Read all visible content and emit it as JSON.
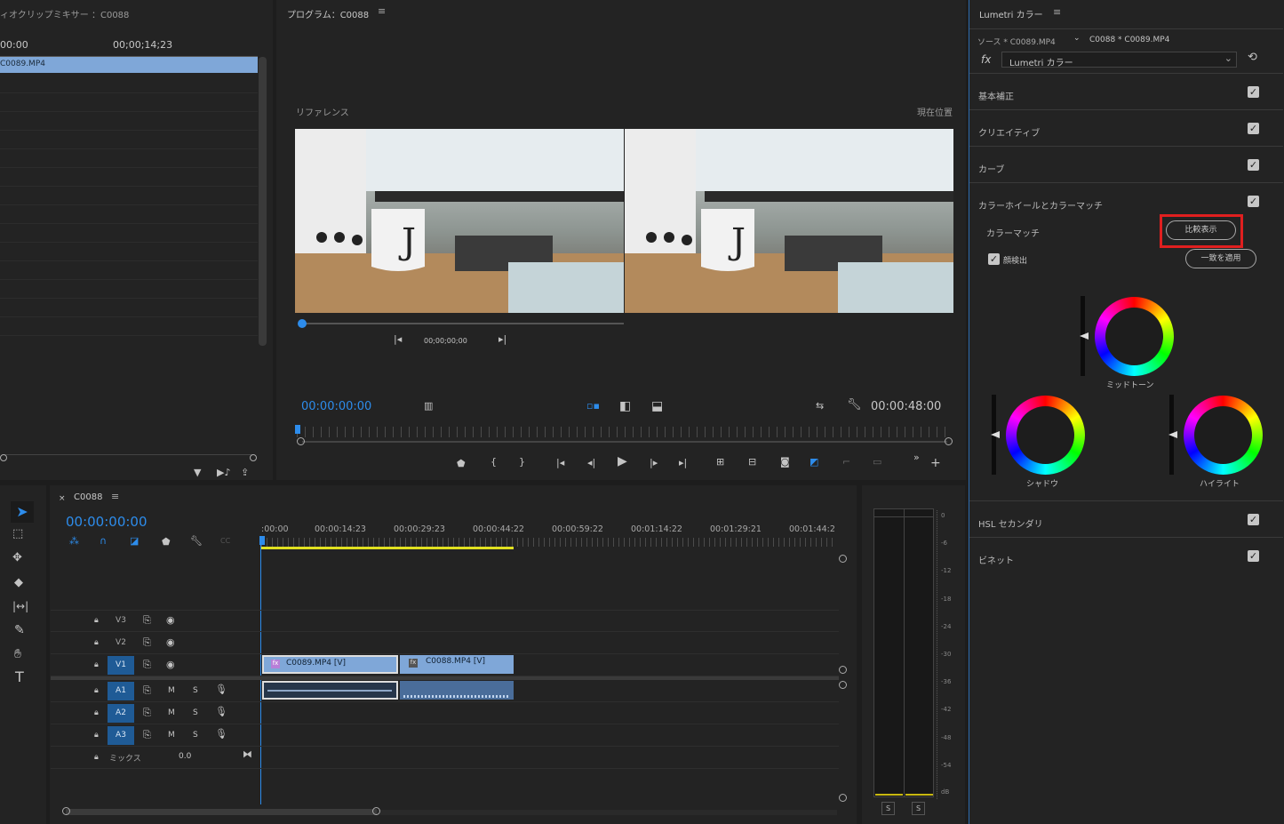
{
  "colors": {
    "accent": "#2d8ceb",
    "clip_blue": "#7fa7d8",
    "clip_header": "#6f8fbd",
    "track_on": "#1f5b96",
    "yellow": "#e0e020",
    "highlight": "#e01f1f"
  },
  "source_panel": {
    "title": "ィオクリップミキサー ：C0088",
    "time_start": "00:00",
    "time_mid": "00;00;14;23",
    "clip": "C0089.MP4"
  },
  "program": {
    "title": "プログラム：C0088",
    "reference_label": "リファレンス",
    "current_label": "現在位置",
    "ref_timecode": "00;00;00;00",
    "timecode": "00:00:00:00",
    "duration": "00:00:48:00"
  },
  "lumetri": {
    "title": "Lumetri カラー",
    "source": "ソース * C0089.MP4",
    "sequence": "C0088 * C0089.MP4",
    "effect": "Lumetri カラー",
    "sections": [
      {
        "label": "基本補正"
      },
      {
        "label": "クリエイティブ"
      },
      {
        "label": "カーブ"
      },
      {
        "label": "カラーホイールとカラーマッチ"
      }
    ],
    "colormatch_label": "カラーマッチ",
    "compare_btn": "比較表示",
    "face_detect": "顔検出",
    "apply_btn": "一致を適用",
    "midtone": "ミッドトーン",
    "shadow": "シャドウ",
    "highlight": "ハイライト",
    "sections_after": [
      {
        "label": "HSL セカンダリ"
      },
      {
        "label": "ビネット"
      }
    ]
  },
  "timeline": {
    "tab": "C0088",
    "timecode": "00:00:00:00",
    "ruler": [
      ":00:00",
      "00:00:14:23",
      "00:00:29:23",
      "00:00:44:22",
      "00:00:59:22",
      "00:01:14:22",
      "00:01:29:21",
      "00:01:44:2"
    ],
    "video_tracks": [
      "V3",
      "V2",
      "V1"
    ],
    "audio_tracks": [
      "A1",
      "A2",
      "A3"
    ],
    "mix_label": "ミックス",
    "mix_value": "0.0",
    "clip1": "C0089.MP4 [V]",
    "clip2": "C0088.MP4 [V]",
    "m": "M",
    "s": "S"
  },
  "meter": {
    "scale": [
      "0",
      "-6",
      "-12",
      "-18",
      "-24",
      "-30",
      "-36",
      "-42",
      "-48",
      "-54",
      "dB"
    ],
    "solo": "S"
  }
}
